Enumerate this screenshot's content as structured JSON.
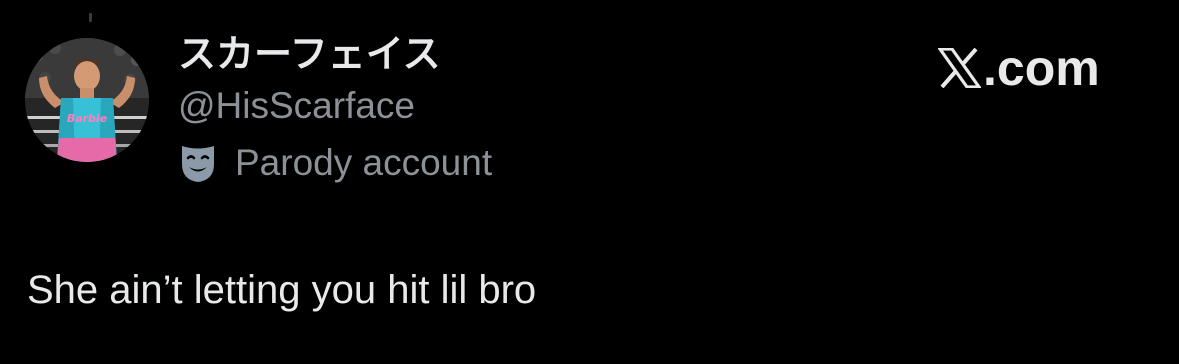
{
  "tweet": {
    "display_name": "スカーフェイス",
    "handle": "@HisScarface",
    "parody_label": "Parody account",
    "text": "She ain’t letting you hit lil bro"
  },
  "brand": {
    "name": ".com",
    "logo_icon": "x-logo-icon"
  },
  "avatar": {
    "jersey_text": "Barbie"
  },
  "colors": {
    "background": "#000000",
    "primary_text": "#e7e9ea",
    "secondary_text": "#8b9197",
    "parody_icon": "#8b9aa8"
  }
}
